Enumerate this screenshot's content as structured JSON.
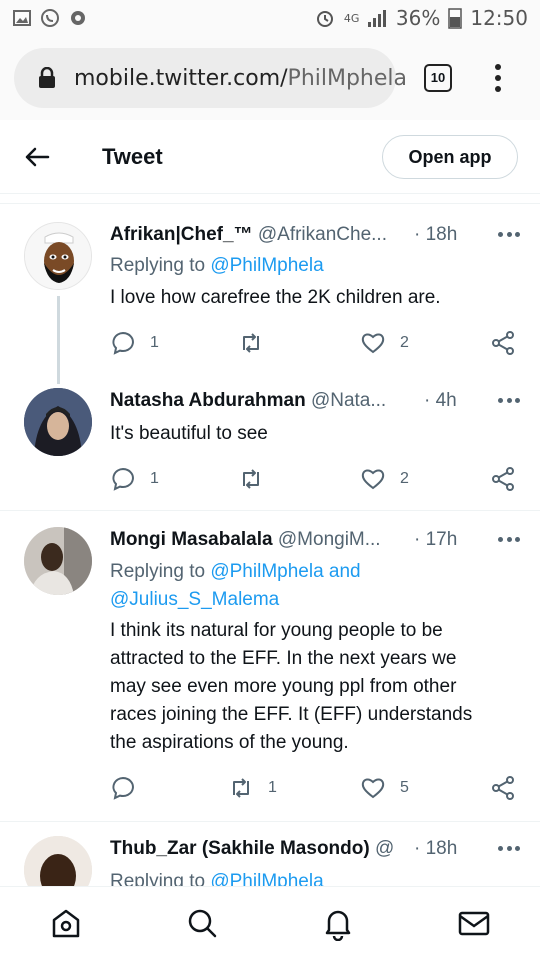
{
  "status_bar": {
    "battery_percent": "36%",
    "time": "12:50",
    "network": "4G"
  },
  "browser": {
    "url_domain": "mobile.twitter.com/",
    "url_path": "PhilMphela",
    "tab_count": "10"
  },
  "header": {
    "title": "Tweet",
    "open_app_label": "Open app"
  },
  "tweets": [
    {
      "name": "Afrikan|Chef_™",
      "handle": "@AfrikanChe...",
      "time": "· 18h",
      "reply_prefix": "Replying to ",
      "reply_mentions": "@PhilMphela",
      "reply_line2": "",
      "text": "I love how carefree the 2K children are.",
      "replies": "1",
      "retweets": "",
      "likes": "2"
    },
    {
      "name": "Natasha Abdurahman",
      "handle": "@Nata...",
      "time": "· 4h",
      "text": "It's beautiful to see",
      "replies": "1",
      "retweets": "",
      "likes": "2"
    },
    {
      "name": "Mongi Masabalala",
      "handle": "@MongiM...",
      "time": "· 17h",
      "reply_prefix": "Replying to ",
      "reply_mentions": "@PhilMphela and",
      "reply_line2": "@Julius_S_Malema",
      "text_lines": [
        "I think its natural for young people to be",
        "attracted to the EFF. In the next years we",
        "may see even more young ppl from other",
        "races joining the EFF. It (EFF) understands",
        "the aspirations of the young."
      ],
      "replies": "",
      "retweets": "1",
      "likes": "5"
    },
    {
      "name": "Thub_Zar (Sakhile Masondo)",
      "handle": "@",
      "time": "· 18h",
      "reply_prefix": "Replying to ",
      "reply_mentions": "@PhilMphela"
    }
  ],
  "colors": {
    "accent": "#1d9bf0",
    "secondary_text": "#536471"
  }
}
